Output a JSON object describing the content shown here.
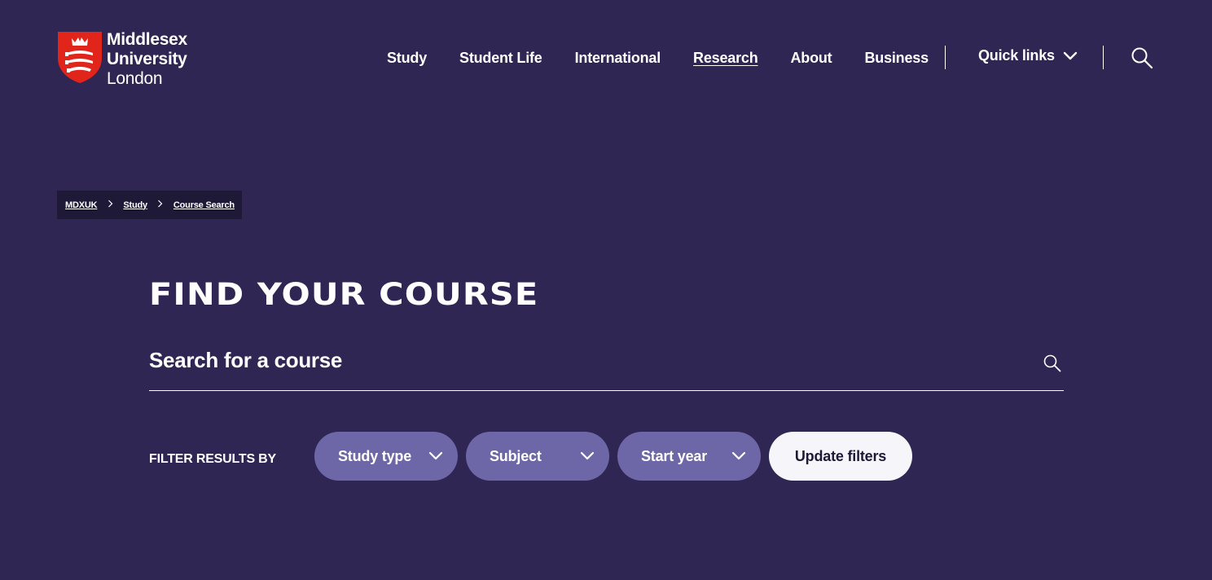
{
  "brand": {
    "name_line1": "Middlesex",
    "name_line2": "University",
    "name_line3": "London",
    "shield_color": "#e1251b"
  },
  "nav": {
    "items": [
      {
        "label": "Study",
        "active": false
      },
      {
        "label": "Student Life",
        "active": false
      },
      {
        "label": "International",
        "active": false
      },
      {
        "label": "Research",
        "active": true
      },
      {
        "label": "About",
        "active": false
      },
      {
        "label": "Business",
        "active": false
      }
    ],
    "quick_links_label": "Quick links",
    "search_icon": "search-icon"
  },
  "breadcrumb": {
    "items": [
      "MDXUK",
      "Study",
      "Course Search"
    ],
    "separator": ">"
  },
  "main": {
    "title": "FIND YOUR COURSE",
    "search_placeholder": "Search for a course",
    "filter_label": "FILTER RESULTS BY",
    "filters": [
      {
        "label": "Study type"
      },
      {
        "label": "Subject"
      },
      {
        "label": "Start year"
      }
    ],
    "update_button": "Update filters"
  },
  "colors": {
    "background": "#2f2653",
    "breadcrumb_bg": "#1f1938",
    "filter_pill": "#6d67a8",
    "update_button_bg": "#f6f6fa",
    "text": "#ffffff"
  }
}
